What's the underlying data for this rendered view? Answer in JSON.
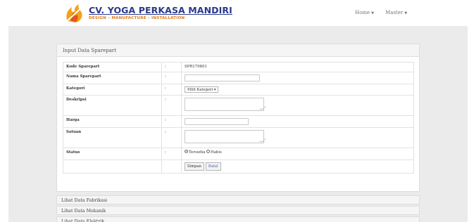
{
  "brand": {
    "title": "CV. YOGA PERKASA MANDIRI",
    "subtitle": "DESIGN – MANUFACTURE – INSTALLATION",
    "accent": "#2a3a8c",
    "secondary": "#e07b1a"
  },
  "nav": {
    "home": "Home",
    "master": "Master"
  },
  "panel": {
    "title": "Input Data Sparepart"
  },
  "form": {
    "separator": ":",
    "kode_label": "Kode Sparepart",
    "kode_value": "SPR170801",
    "nama_label": "Nama Sparepart",
    "kategori_label": "Kategori",
    "kategori_selected": "Pilih Kategori",
    "deskripsi_label": "Deskripsi",
    "harga_label": "Harga",
    "satuan_label": "Satuan",
    "status_label": "Status",
    "status_options": [
      "Tersedia",
      "Habis"
    ],
    "status_selected": "Tersedia",
    "save_label": "Simpan",
    "reset_label": "Batal"
  },
  "sections": [
    "Lihat Data Fabrikasi",
    "Lihat Data Mekanik",
    "Lihat Data Elektrik"
  ]
}
